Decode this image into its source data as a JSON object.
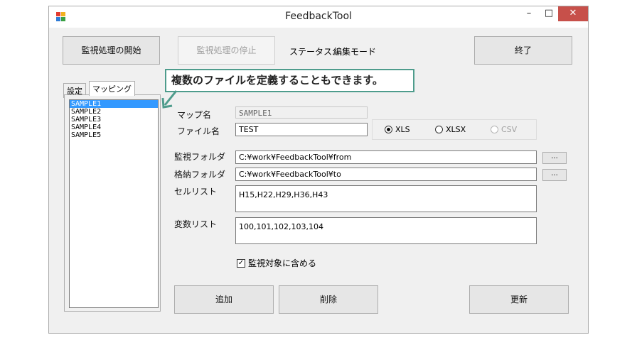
{
  "window": {
    "title": "FeedbackTool",
    "minimize": "–",
    "maximize": "□",
    "close": "✕"
  },
  "toolbar": {
    "start_label": "監視処理の開始",
    "stop_label": "監視処理の停止",
    "status_label": "ステータス:",
    "status_value": "編集モード",
    "exit_label": "終了"
  },
  "callout": {
    "text": "複数のファイルを定義することもできます。"
  },
  "tabs": [
    {
      "label": "設定",
      "active": false
    },
    {
      "label": "マッピング",
      "active": true
    }
  ],
  "mapping_list": {
    "items": [
      "SAMPLE1",
      "SAMPLE2",
      "SAMPLE3",
      "SAMPLE4",
      "SAMPLE5"
    ],
    "selected": "SAMPLE1"
  },
  "form": {
    "map_name_label": "マップ名",
    "map_name_value": "SAMPLE1",
    "file_name_label": "ファイル名",
    "file_name_value": "TEST",
    "format_options": [
      {
        "label": "XLS",
        "checked": true,
        "disabled": false
      },
      {
        "label": "XLSX",
        "checked": false,
        "disabled": false
      },
      {
        "label": "CSV",
        "checked": false,
        "disabled": true
      }
    ],
    "watch_folder_label": "監視フォルダ",
    "watch_folder_value": "C:¥work¥FeedbackTool¥from",
    "store_folder_label": "格納フォルダ",
    "store_folder_value": "C:¥work¥FeedbackTool¥to",
    "browse_label": "...",
    "cell_list_label": "セルリスト",
    "cell_list_value": "H15,H22,H29,H36,H43",
    "var_list_label": "変数リスト",
    "var_list_value": "100,101,102,103,104",
    "include_label": "監視対象に含める",
    "include_checked": true
  },
  "actions": {
    "add_label": "追加",
    "delete_label": "削除",
    "update_label": "更新"
  },
  "colors": {
    "callout_border": "#4e9c8c",
    "selection": "#3399ff",
    "close_button": "#c7504a"
  }
}
